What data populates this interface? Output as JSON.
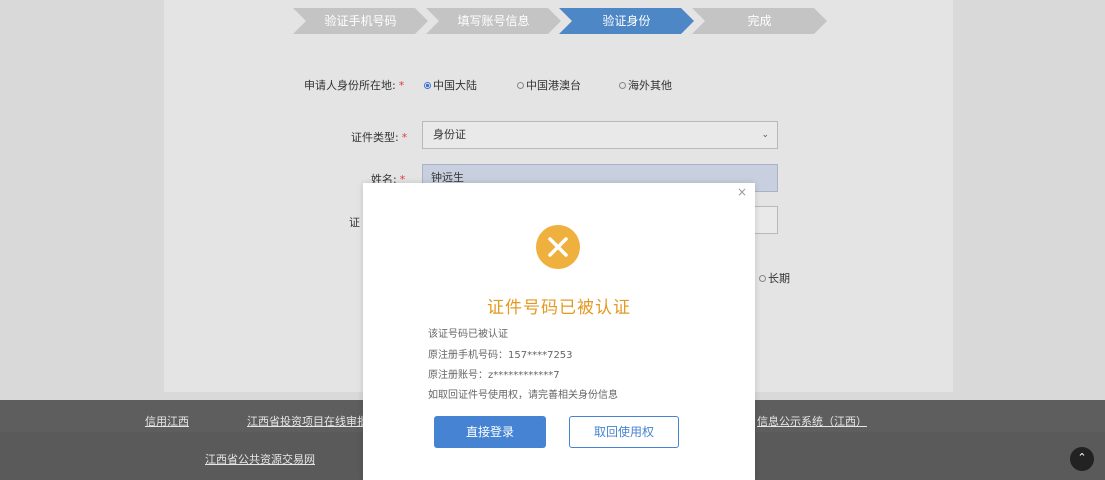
{
  "steps": [
    "验证手机号码",
    "填写账号信息",
    "验证身份",
    "完成"
  ],
  "form": {
    "location_label": "申请人身份所在地:",
    "location_options": [
      "中国大陆",
      "中国港澳台",
      "海外其他"
    ],
    "location_selected": "中国大陆",
    "id_type_label": "证件类型:",
    "id_type_value": "身份证",
    "name_label": "姓名:",
    "name_value": "钟远生",
    "id_number_label_partial": "证",
    "validity_label_partial": "",
    "validity_long_option": "长期",
    "required_mark": "*"
  },
  "modal": {
    "close_symbol": "×",
    "title": "证件号码已被认证",
    "line1": "该证号码已被认证",
    "line2": "原注册手机号码：157****7253",
    "line3": "原注册账号：z************7",
    "line4": "如取回证件号使用权，请完善相关身份信息",
    "login_button": "直接登录",
    "reclaim_button": "取回使用权"
  },
  "footer": {
    "links_row1": [
      "信用江西",
      "江西省投资项目在线审批",
      "信息公示系统（江西）"
    ],
    "links_row2": [
      "江西省公共资源交易网"
    ]
  },
  "colors": {
    "accent_blue": "#4683d2",
    "warning_orange": "#efb03d",
    "title_orange": "#e49a22",
    "required_red": "#e03c3c"
  }
}
